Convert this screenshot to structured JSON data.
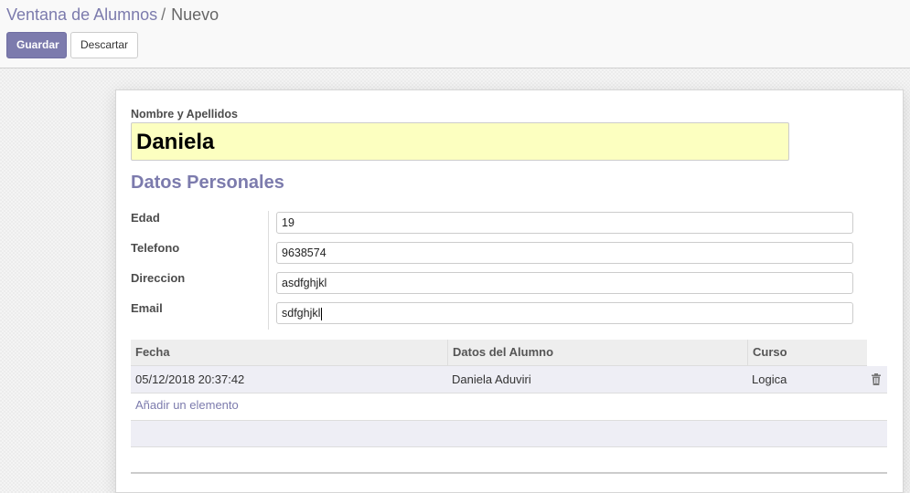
{
  "breadcrumb": {
    "parent": "Ventana de Alumnos",
    "separator": "/",
    "current": "Nuevo"
  },
  "toolbar": {
    "save_label": "Guardar",
    "discard_label": "Descartar"
  },
  "form": {
    "name_label": "Nombre y Apellidos",
    "name_value": "Daniela",
    "section_title": "Datos Personales",
    "fields": [
      {
        "label": "Edad",
        "value": "19"
      },
      {
        "label": "Telefono",
        "value": "9638574"
      },
      {
        "label": "Direccion",
        "value": "asdfghjkl"
      },
      {
        "label": "Email",
        "value": "sdfghjkl"
      }
    ]
  },
  "table": {
    "columns": [
      "Fecha",
      "Datos del Alumno",
      "Curso"
    ],
    "rows": [
      {
        "fecha": "05/12/2018 20:37:42",
        "alumno": "Daniela Aduviri",
        "curso": "Logica"
      }
    ],
    "add_line_label": "Añadir un elemento"
  },
  "colors": {
    "accent": "#7c7bad",
    "required_field_bg": "#fcffc0",
    "row_bg": "#eeeef5"
  },
  "icons": {
    "delete_row": "trash-icon"
  }
}
